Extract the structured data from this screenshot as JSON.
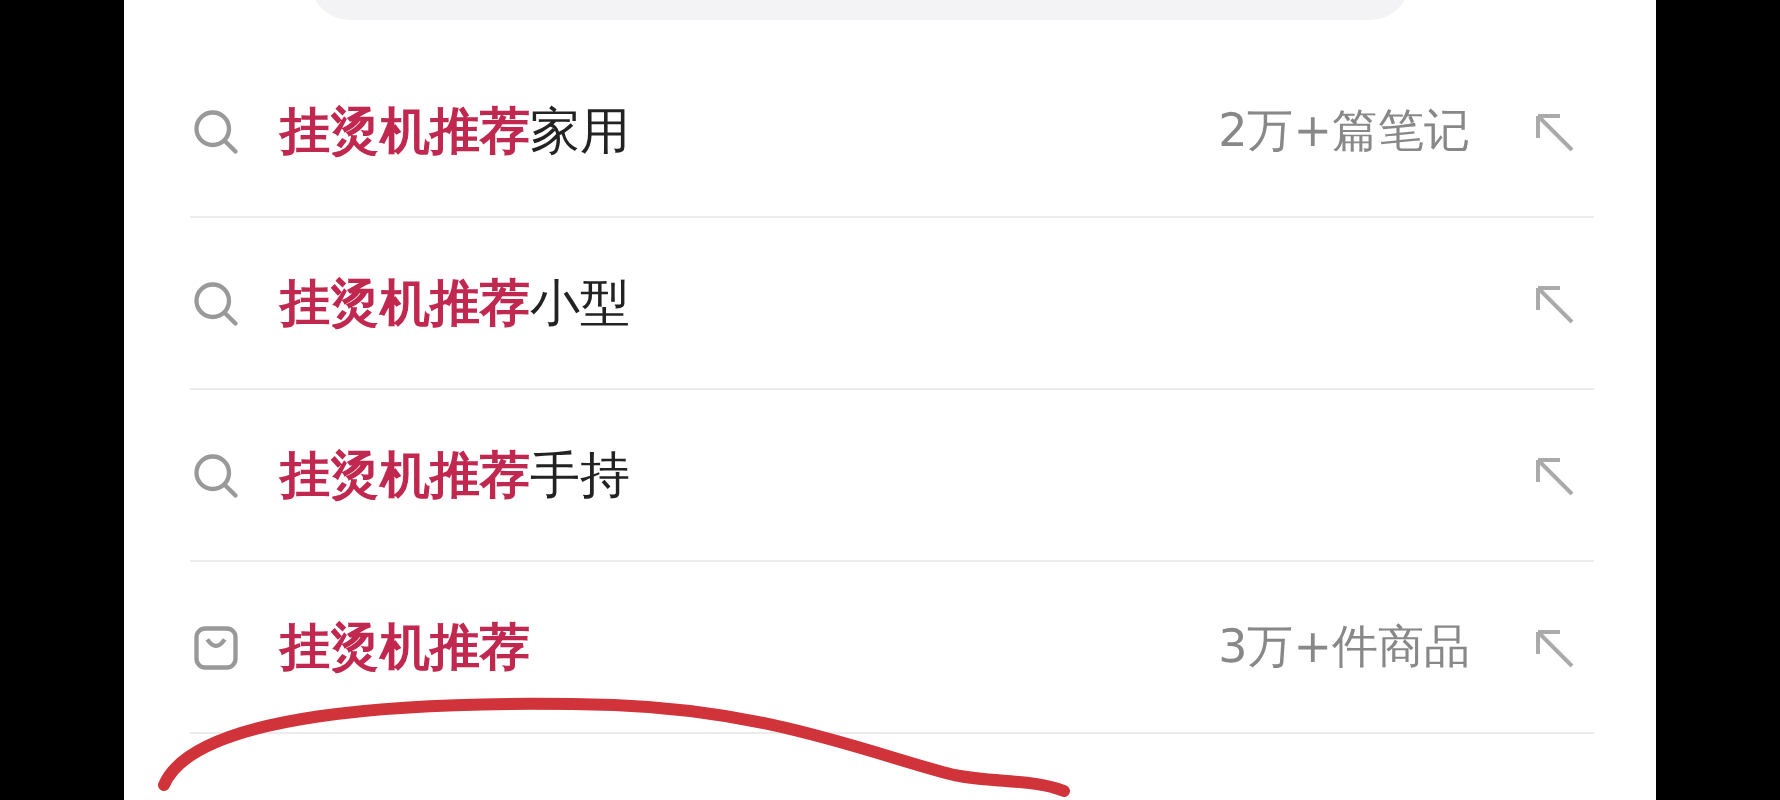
{
  "suggestions": [
    {
      "kind": "search",
      "match": "挂烫机推荐",
      "rest": "家用",
      "count": "2万+篇笔记"
    },
    {
      "kind": "search",
      "match": "挂烫机推荐",
      "rest": "小型"
    },
    {
      "kind": "search",
      "match": "挂烫机推荐",
      "rest": "手持"
    },
    {
      "kind": "product",
      "match": "挂烫机推荐",
      "count": "3万+件商品"
    }
  ]
}
